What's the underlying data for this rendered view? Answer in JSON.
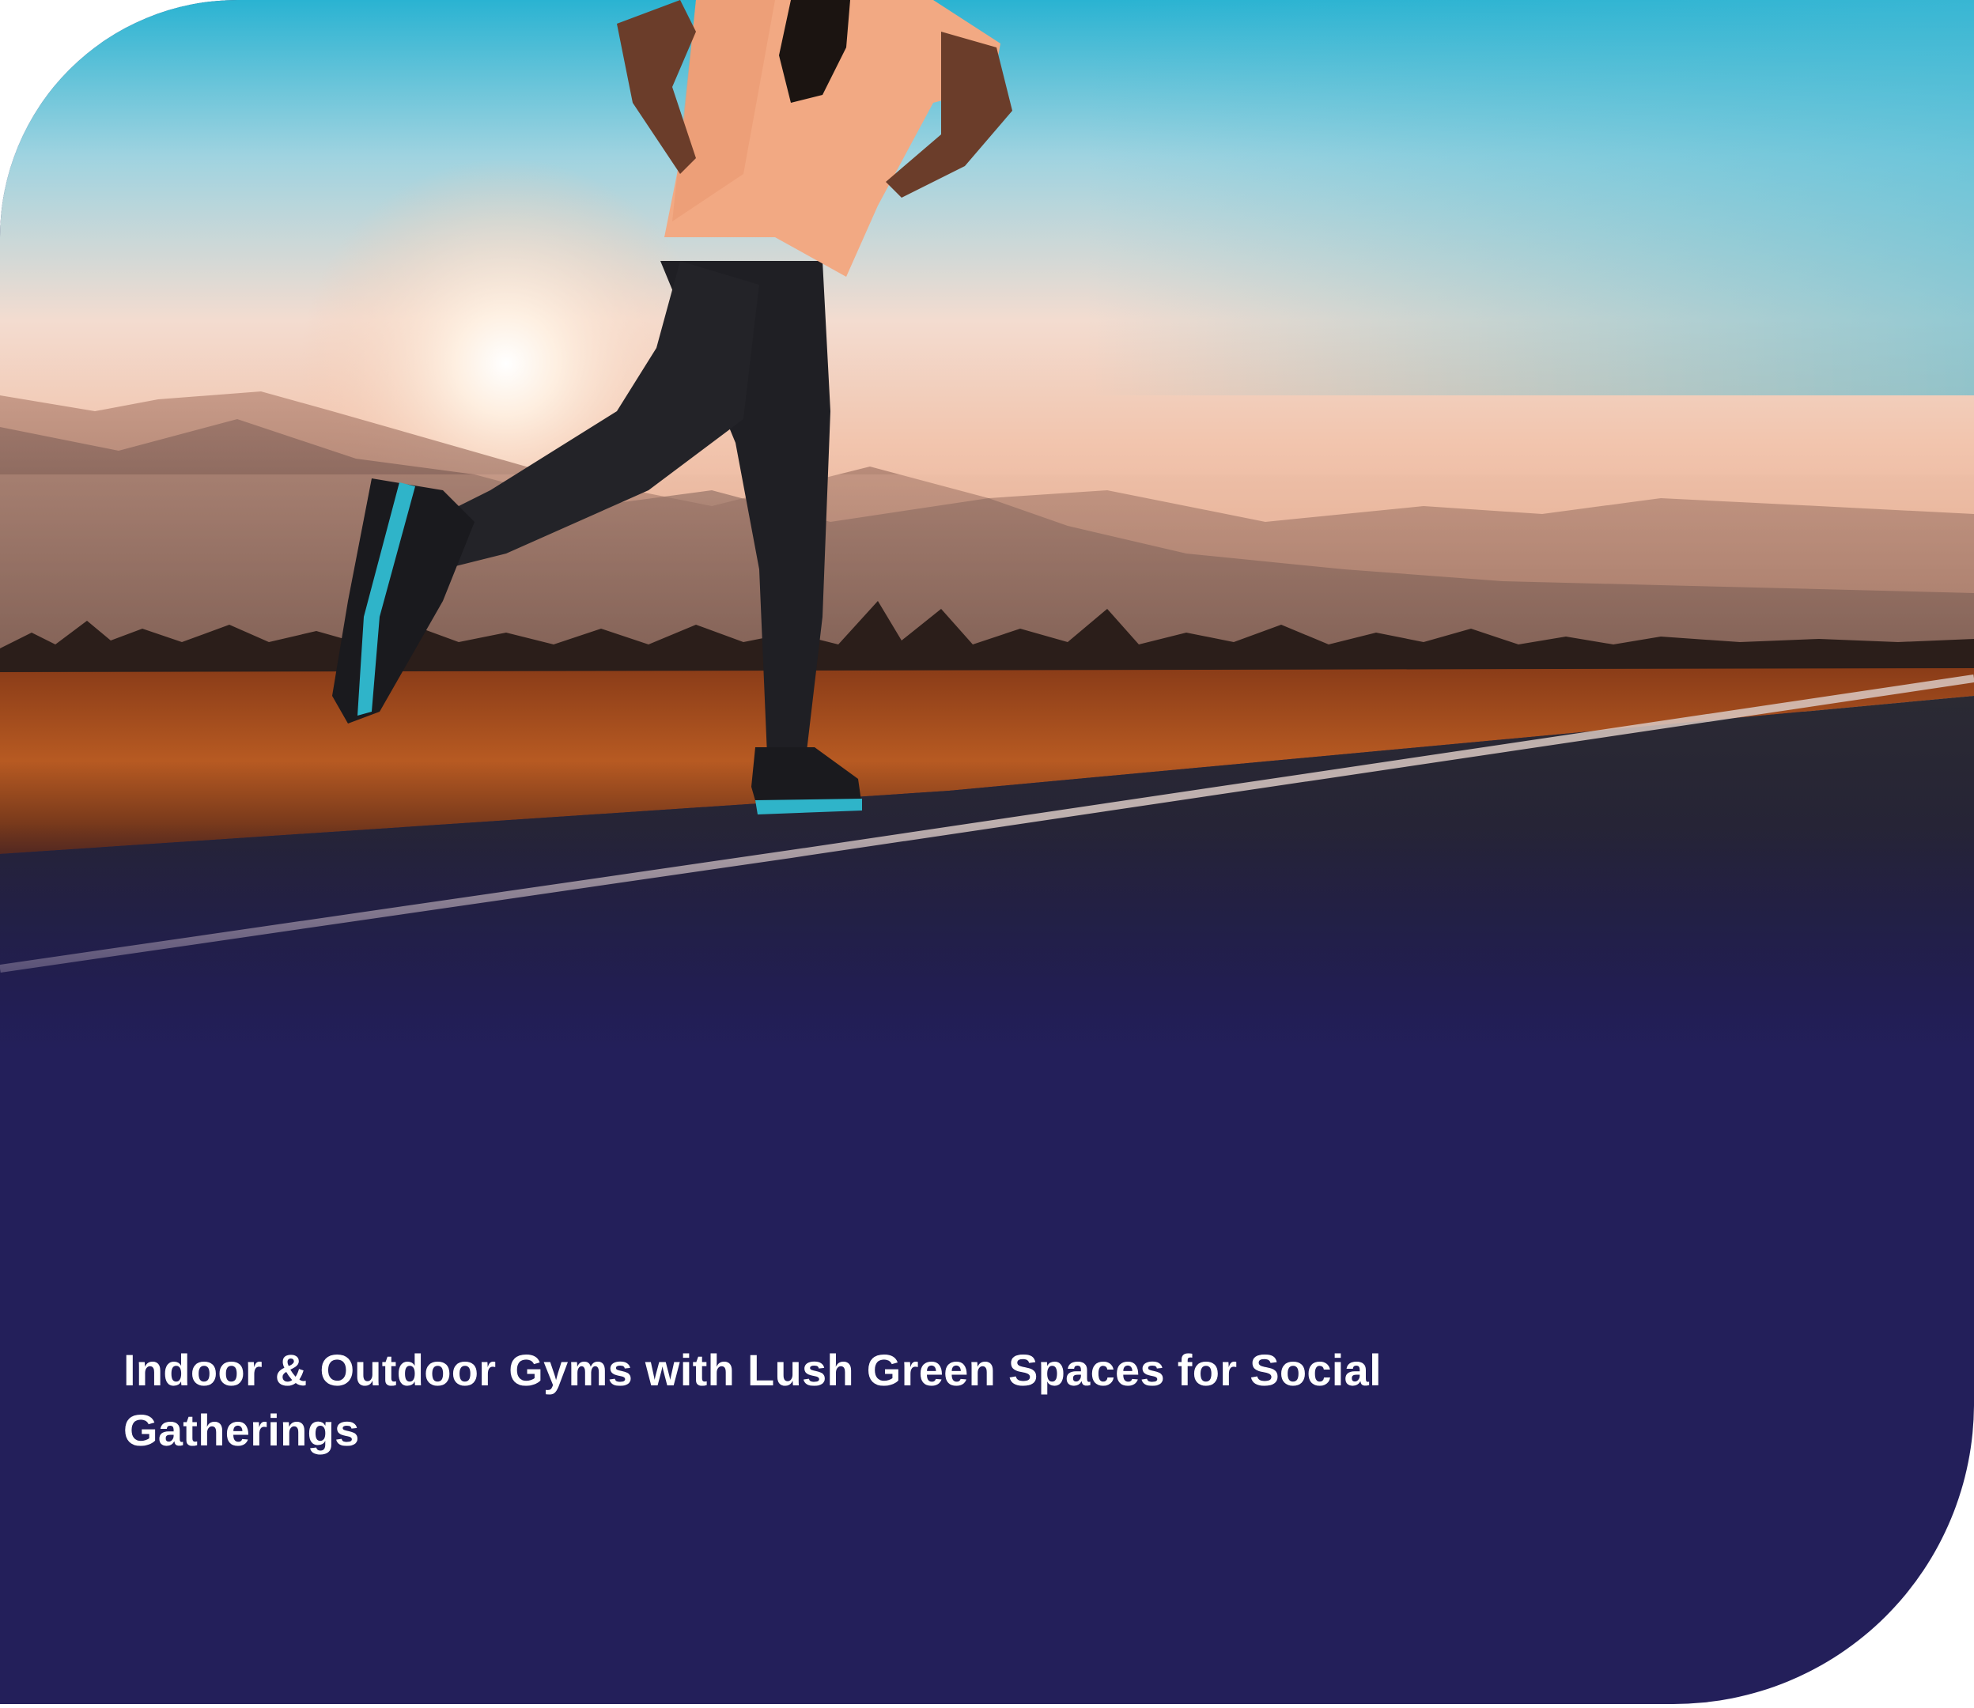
{
  "hero": {
    "image_icon": "runner-on-road-at-sunset-photo"
  },
  "feature": {
    "title": "Indoor & Outdoor Gyms with Lush Green Spaces for Social Gatherings"
  },
  "colors": {
    "panel": "#231f5a",
    "text": "#ffffff",
    "sky_top": "#2bb3d1",
    "sunset": "#f2c2a8",
    "field": "#a84a1c"
  }
}
